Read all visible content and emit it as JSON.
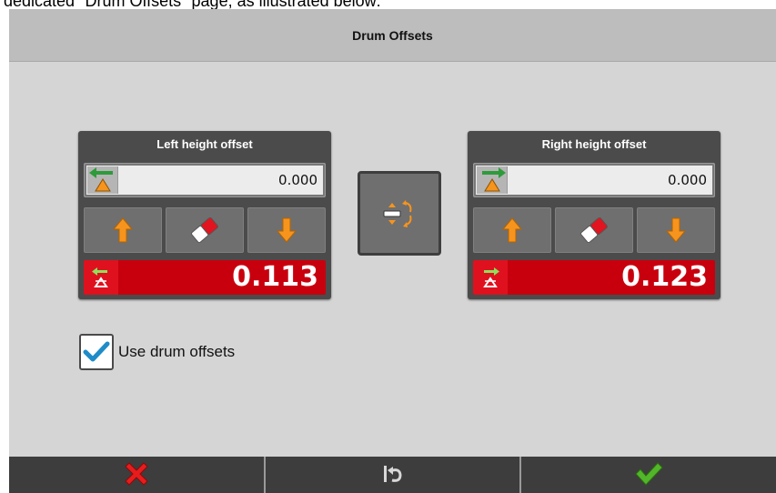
{
  "caption": "dedicated \"Drum Offsets\" page, as illustrated below:",
  "window": {
    "title": "Drum Offsets"
  },
  "left_panel": {
    "title": "Left height offset",
    "setpoint_value": "0.000",
    "readout_value": "0.113"
  },
  "right_panel": {
    "title": "Right height offset",
    "setpoint_value": "0.000",
    "readout_value": "0.123"
  },
  "use_drum_offsets": {
    "label": "Use drum offsets",
    "checked": true
  },
  "colors": {
    "background": "#d5d5d5",
    "titlebar": "#bdbdbd",
    "panel": "#4b4b4b",
    "readout_red": "#c8000e",
    "accent_orange": "#f7941d",
    "arrow_green": "#2e9b3b",
    "checkbox_blue": "#1e8cc8",
    "cancel_red": "#e81c1c",
    "confirm_green": "#52b52a"
  },
  "icons": {
    "cancel": "cancel-x-icon",
    "undo": "undo-icon",
    "confirm": "checkmark-icon",
    "swap": "swap-offsets-icon",
    "increase": "arrow-up-icon",
    "decrease": "arrow-down-icon",
    "clear": "eraser-icon"
  }
}
